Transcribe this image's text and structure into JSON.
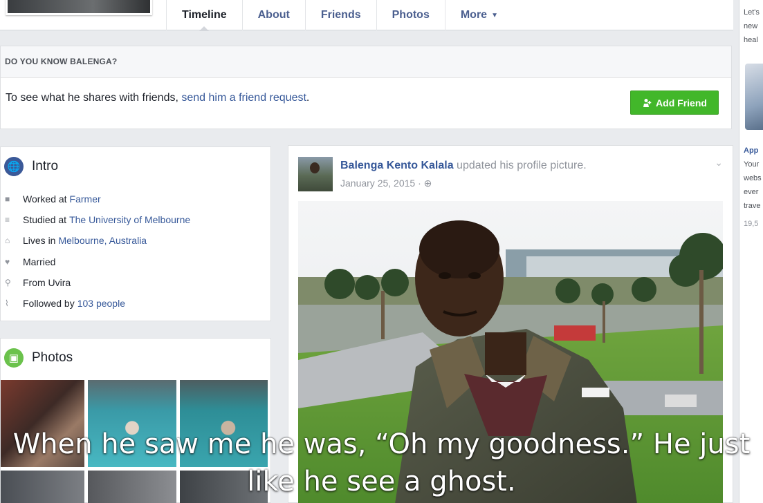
{
  "nav": {
    "tabs": [
      {
        "label": "Timeline"
      },
      {
        "label": "About"
      },
      {
        "label": "Friends"
      },
      {
        "label": "Photos"
      },
      {
        "label": "More"
      }
    ]
  },
  "friend_prompt": {
    "heading": "DO YOU KNOW BALENGA?",
    "text_before": "To see what he shares with friends, ",
    "link": "send him a friend request",
    "text_after": ".",
    "button": "Add Friend"
  },
  "intro": {
    "title": "Intro",
    "items": [
      {
        "icon": "briefcase-icon",
        "text": "Worked at",
        "link": "Farmer"
      },
      {
        "icon": "graduation-cap-icon",
        "text": "Studied at",
        "link": "The University of Melbourne"
      },
      {
        "icon": "house-icon",
        "text": "Lives in",
        "link": "Melbourne, Australia"
      },
      {
        "icon": "heart-icon",
        "text": "Married",
        "link": ""
      },
      {
        "icon": "location-pin-icon",
        "text": "From Uvira",
        "link": ""
      },
      {
        "icon": "rss-icon",
        "text": "Followed by",
        "link": "103 people"
      }
    ]
  },
  "photos_card": {
    "title": "Photos"
  },
  "post": {
    "author": "Balenga Kento Kalala",
    "action": " updated his profile picture.",
    "date": "January 25, 2015 ·"
  },
  "right_sidebar": {
    "lines_top": [
      "Let's",
      "new",
      "heal"
    ],
    "ad_title": "App",
    "lines_bottom": [
      "Your",
      "webs",
      "ever",
      "trave"
    ],
    "count": "19,5"
  },
  "caption": {
    "line1": "When he saw me he was, “Oh my goodness.” He just",
    "line2": "like he see a ghost."
  },
  "colors": {
    "link": "#365899",
    "add_friend": "#42b72a",
    "background": "#e9ebee"
  }
}
